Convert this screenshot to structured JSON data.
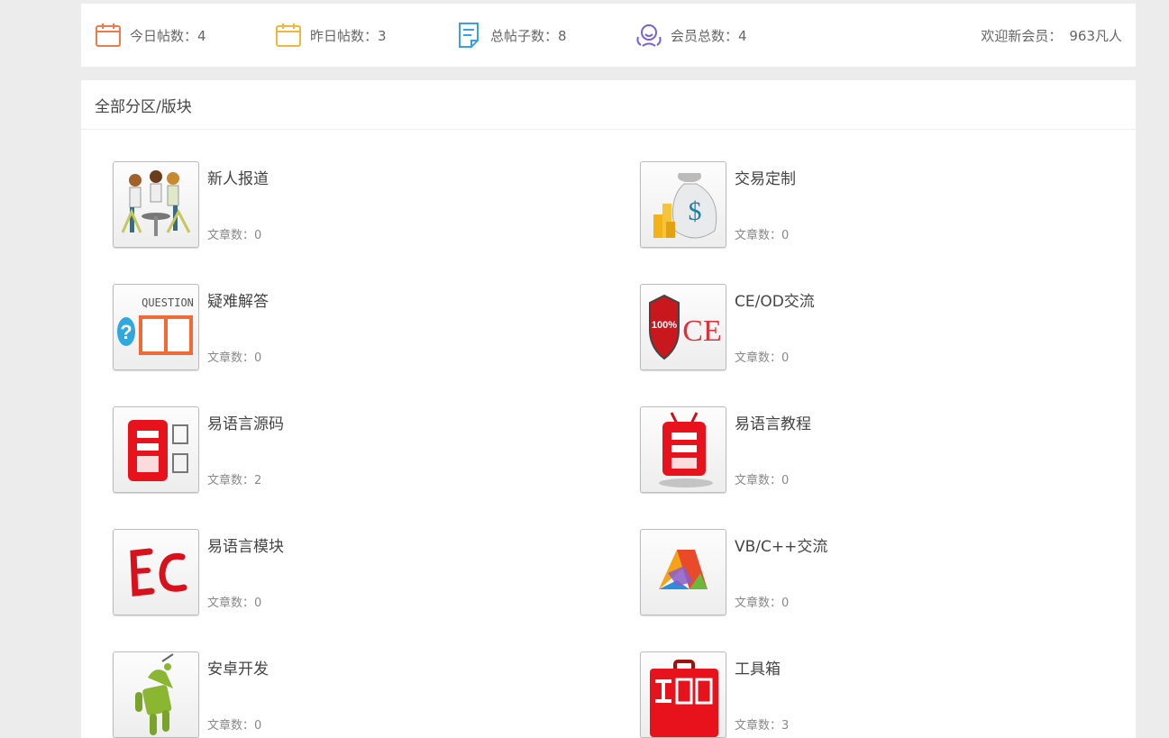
{
  "stats": {
    "today": {
      "label": "今日帖数：4",
      "icon": "calendar-icon",
      "color": "#f07a4a"
    },
    "yesterday": {
      "label": "昨日帖数：3",
      "icon": "calendar-icon",
      "color": "#f3b63c"
    },
    "total_posts": {
      "label": "总帖子数：8",
      "icon": "document-icon",
      "color": "#3aa0e6"
    },
    "members": {
      "label": "会员总数：4",
      "icon": "members-icon",
      "color": "#7a5fd6"
    },
    "welcome_label": "欢迎新会员：",
    "welcome_member": "963凡人"
  },
  "section": {
    "title": "全部分区/版块"
  },
  "forums": [
    {
      "name": "新人报道",
      "count_label": "文章数：0",
      "icon": "meeting-people-icon"
    },
    {
      "name": "交易定制",
      "count_label": "文章数：0",
      "icon": "money-bag-icon"
    },
    {
      "name": "疑难解答",
      "count_label": "文章数：0",
      "icon": "question-answer-icon"
    },
    {
      "name": "CE/OD交流",
      "count_label": "文章数：0",
      "icon": "ce-shield-icon"
    },
    {
      "name": "易语言源码",
      "count_label": "文章数：2",
      "icon": "eyuyan-source-icon"
    },
    {
      "name": "易语言教程",
      "count_label": "文章数：0",
      "icon": "eyuyan-tutorial-icon"
    },
    {
      "name": "易语言模块",
      "count_label": "文章数：0",
      "icon": "ec-module-icon"
    },
    {
      "name": "VB/C++交流",
      "count_label": "文章数：0",
      "icon": "visual-studio-icon"
    },
    {
      "name": "安卓开发",
      "count_label": "文章数：0",
      "icon": "android-icon"
    },
    {
      "name": "工具箱",
      "count_label": "文章数：3",
      "icon": "toolbox-icon"
    }
  ]
}
